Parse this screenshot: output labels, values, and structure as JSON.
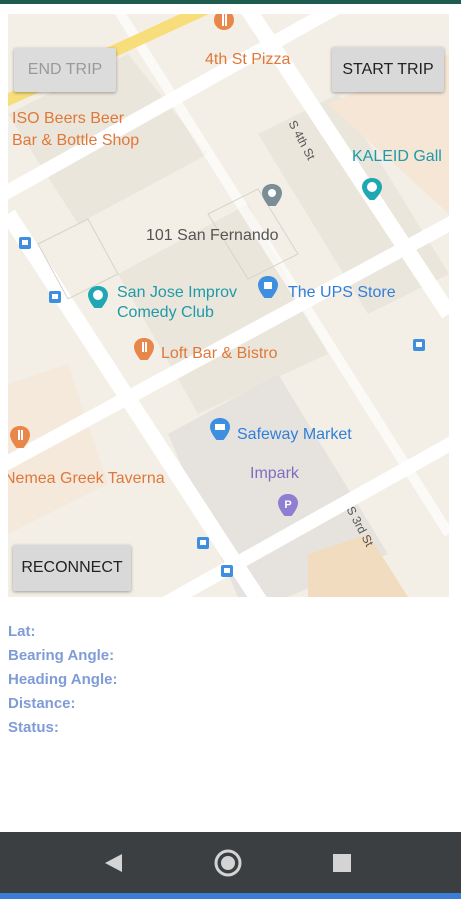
{
  "map": {
    "labels": {
      "pizza": "4th St Pizza",
      "beers_line1": "ISO Beers Beer",
      "beers_line2": "Bar & Bottle Shop",
      "kaleid": "KALEID Gall",
      "san_fernando": "101 San Fernando",
      "improv_line1": "San Jose Improv",
      "improv_line2": "Comedy Club",
      "ups": "The UPS Store",
      "loft": "Loft Bar & Bistro",
      "safeway": "Safeway Market",
      "nemea": "Nemea Greek Taverna",
      "impark": "Impark",
      "street_4th": "S 4th St",
      "street_3rd": "S 3rd St"
    }
  },
  "buttons": {
    "end_trip": "END TRIP",
    "start_trip": "START TRIP",
    "reconnect": "RECONNECT"
  },
  "info": {
    "lat": "Lat:",
    "bearing": "Bearing Angle:",
    "heading": "Heading Angle:",
    "distance": "Distance:",
    "status": "Status:"
  },
  "nav": {
    "back_icon": "back-triangle",
    "home_icon": "home-circle",
    "recents_icon": "recents-square"
  }
}
